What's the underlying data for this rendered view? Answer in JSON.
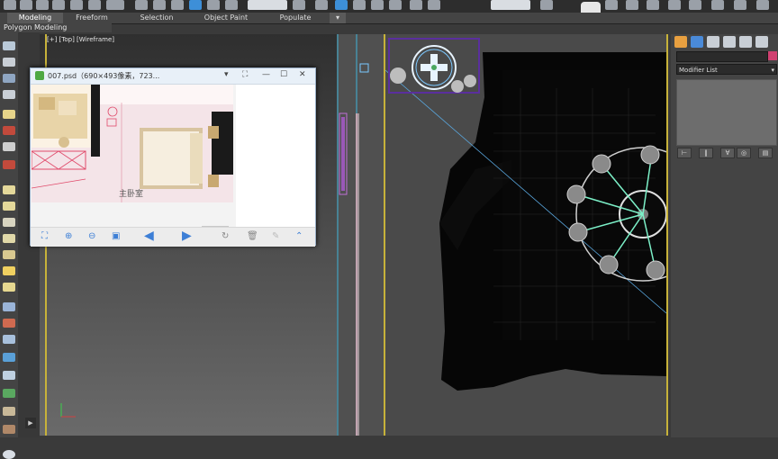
{
  "ribbon": {
    "tabs": [
      "Modeling",
      "Freeform",
      "Selection",
      "Object Paint",
      "Populate"
    ],
    "active_tab": "Modeling",
    "sub_label": "Polygon Modeling"
  },
  "viewport": {
    "label": "[+] [Top] [Wireframe]"
  },
  "image_viewer": {
    "title": "007.psd（690×493像素，723...",
    "room_label": "主卧室"
  },
  "command_panel": {
    "modifier_list": "Modifier List"
  },
  "colors": {
    "accent_yellow": "#c7b23a",
    "ui_blue": "#3d8fd8",
    "wireframe_black": "#050505",
    "lamp_green": "#7cf0c8",
    "selection_purple": "#5a2f9e"
  }
}
